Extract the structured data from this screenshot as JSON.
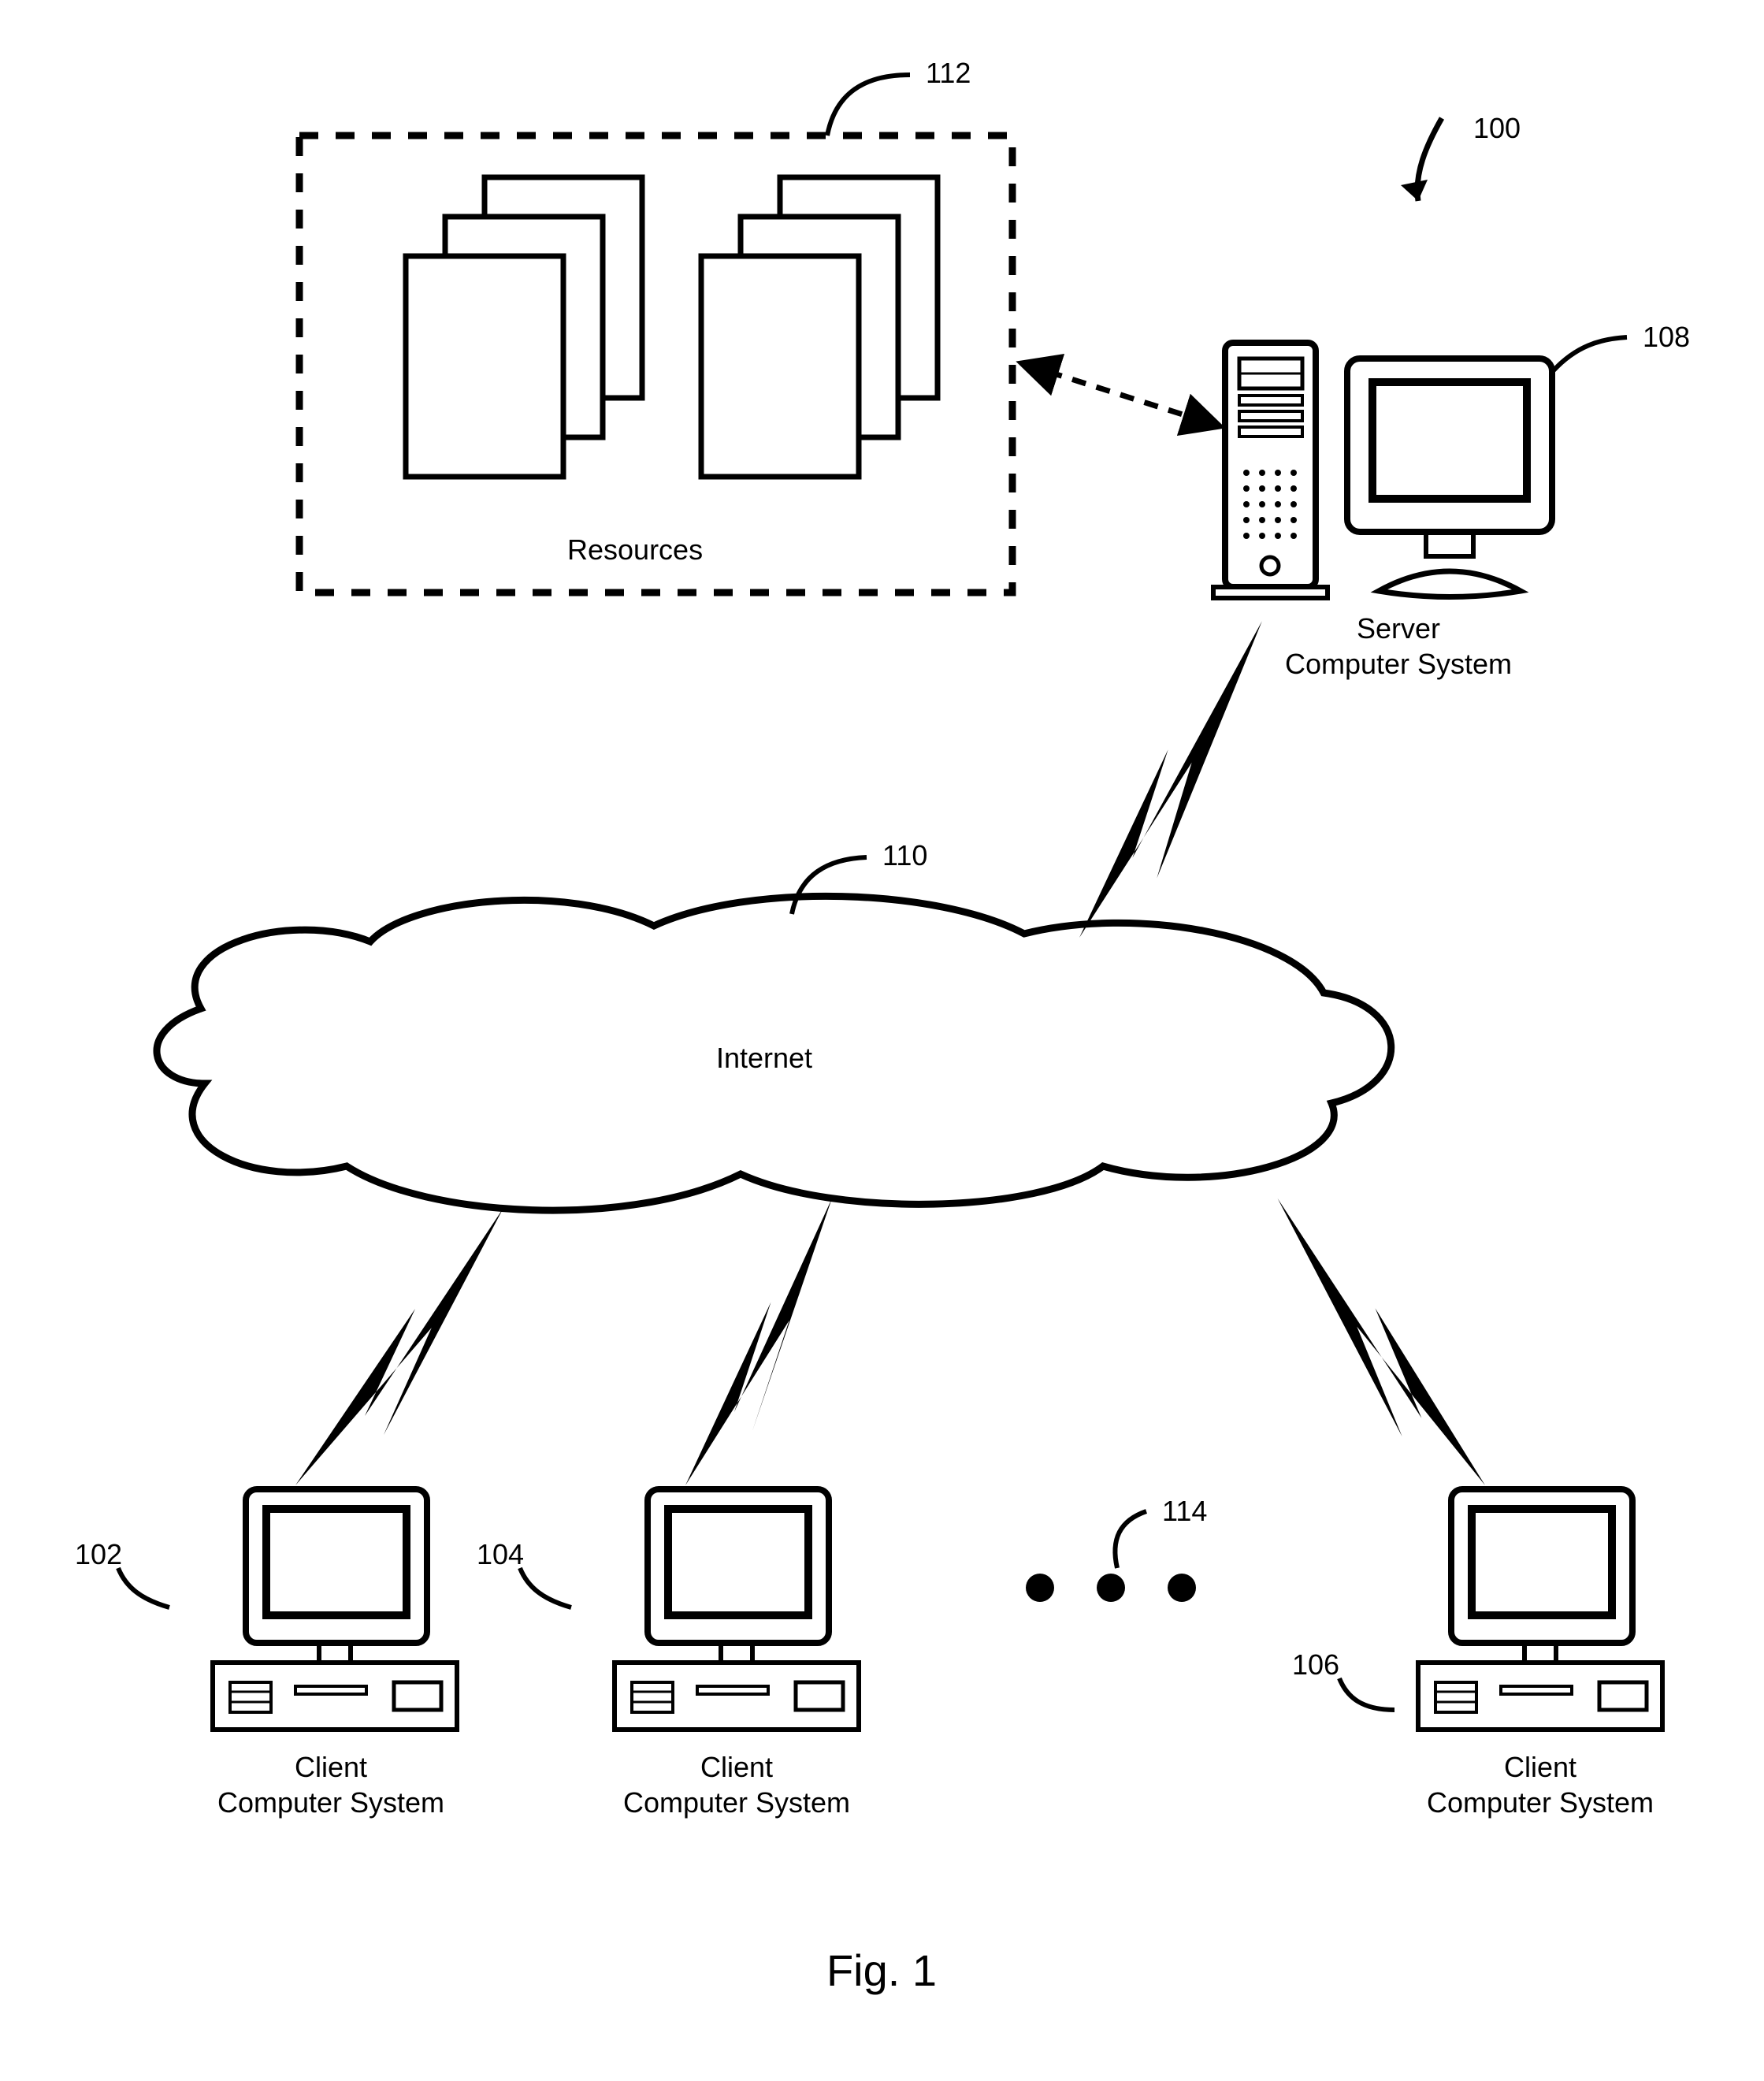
{
  "figure_label": "Fig. 1",
  "refs": {
    "system": "100",
    "client1": "102",
    "client2": "104",
    "client3": "106",
    "server": "108",
    "cloud": "110",
    "resources": "112",
    "ellipsis": "114"
  },
  "labels": {
    "resources": "Resources",
    "internet": "Internet",
    "server_l1": "Server",
    "server_l2": "Computer System",
    "client_l1": "Client",
    "client_l2": "Computer System"
  }
}
